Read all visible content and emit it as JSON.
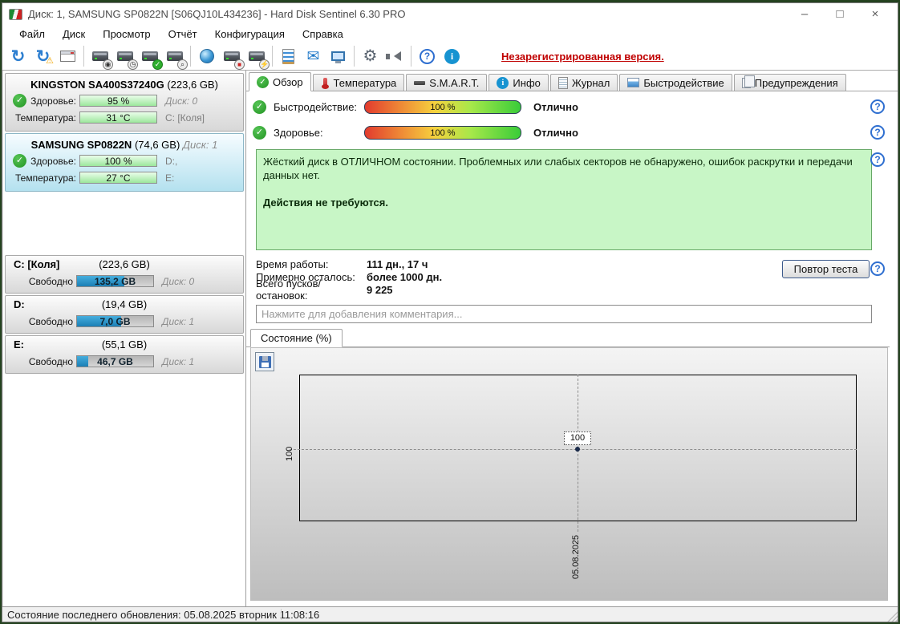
{
  "window": {
    "title": "Диск: 1, SAMSUNG SP0822N [S06QJ10L434236]  -  Hard Disk Sentinel 6.30 PRO",
    "minimize": "–",
    "maximize": "□",
    "close": "×"
  },
  "menu": {
    "items": [
      "Файл",
      "Диск",
      "Просмотр",
      "Отчёт",
      "Конфигурация",
      "Справка"
    ]
  },
  "toolbar": {
    "unregistered": "Незарегистрированная версия.",
    "icons": [
      "refresh-icon",
      "refresh-warning-icon",
      "report-window-icon",
      "disk-performance-icon",
      "disk-clock-icon",
      "disk-check-icon",
      "disk-search-icon",
      "network-disk-icon",
      "disk-hardware-icon",
      "disk-plug-icon",
      "notes-icon",
      "email-icon",
      "network-icon",
      "settings-gear-icon",
      "sounds-speaker-icon",
      "help-icon",
      "info-icon"
    ]
  },
  "sidebar": {
    "drives": [
      {
        "name": "KINGSTON SA400S37240G",
        "size": " (223,6 GB)",
        "disk": "",
        "rows": [
          {
            "label": "Здоровье:",
            "value": "95 %",
            "right": "Диск: 0"
          },
          {
            "label": "Температура:",
            "value": "31 °C",
            "right": "C: [Коля]"
          }
        ]
      },
      {
        "name": "SAMSUNG SP0822N",
        "size": " (74,6 GB) ",
        "disk": "Диск: 1",
        "rows": [
          {
            "label": "Здоровье:",
            "value": "100 %",
            "right": "D:,"
          },
          {
            "label": "Температура:",
            "value": "27 °C",
            "right": "E:"
          }
        ]
      }
    ],
    "partitions": [
      {
        "name": "C: [Коля]",
        "size": "(223,6 GB)",
        "free_label": "Свободно",
        "free": "135,2 GB",
        "disk": "Диск: 0",
        "fill_pct": 62
      },
      {
        "name": "D:",
        "size": "(19,4 GB)",
        "free_label": "Свободно",
        "free": "7,0 GB",
        "disk": "Диск: 1",
        "fill_pct": 58
      },
      {
        "name": "E:",
        "size": "(55,1 GB)",
        "free_label": "Свободно",
        "free": "46,7 GB",
        "disk": "Диск: 1",
        "fill_pct": 15
      }
    ]
  },
  "tabs": [
    {
      "label": "Обзор"
    },
    {
      "label": "Температура"
    },
    {
      "label": "S.M.A.R.T."
    },
    {
      "label": "Инфо"
    },
    {
      "label": "Журнал"
    },
    {
      "label": "Быстродействие"
    },
    {
      "label": "Предупреждения"
    }
  ],
  "overview": {
    "gauges": [
      {
        "label": "Быстродействие:",
        "value": "100 %",
        "status": "Отлично"
      },
      {
        "label": "Здоровье:",
        "value": "100 %",
        "status": "Отлично"
      }
    ],
    "message_line1": "Жёсткий диск в ОТЛИЧНОМ состоянии. Проблемных или слабых секторов не обнаружено, ошибок раскрутки и передачи данных нет.",
    "message_line2": "Действия не требуются.",
    "stats": [
      {
        "label": "Время работы:",
        "value": "111 дн., 17 ч"
      },
      {
        "label": "Примерно осталось:",
        "value": "более 1000 дн."
      },
      {
        "label": "Всего пусков/остановок:",
        "value": "9 225"
      }
    ],
    "retest_button": "Повтор теста",
    "comment_placeholder": "Нажмите для добавления комментария...",
    "help_glyph": "?"
  },
  "chart": {
    "tab": "Состояние (%)",
    "point_label": "100",
    "y_tick": "100",
    "x_tick": "05.08.2025"
  },
  "chart_data": {
    "type": "line",
    "title": "Состояние (%)",
    "x": [
      "05.08.2025"
    ],
    "series": [
      {
        "name": "Состояние (%)",
        "values": [
          100
        ]
      }
    ],
    "y_ticks": [
      "100"
    ],
    "x_ticks": [
      "05.08.2025"
    ],
    "annotations": [
      "100"
    ],
    "grid": "dashed-crosshair",
    "legend": "none"
  },
  "statusbar": {
    "text": "Состояние последнего обновления: 05.08.2025 вторник 11:08:16"
  },
  "colors": {
    "accent_blue": "#1793d1",
    "health_green": "#9ce79c",
    "partition_blue": "#2596be",
    "ok_green_box": "#c8f6c6",
    "unregistered_red": "#c00000",
    "gauge_gradient": [
      "#e23b2e",
      "#f6d23e",
      "#39cc39"
    ]
  }
}
